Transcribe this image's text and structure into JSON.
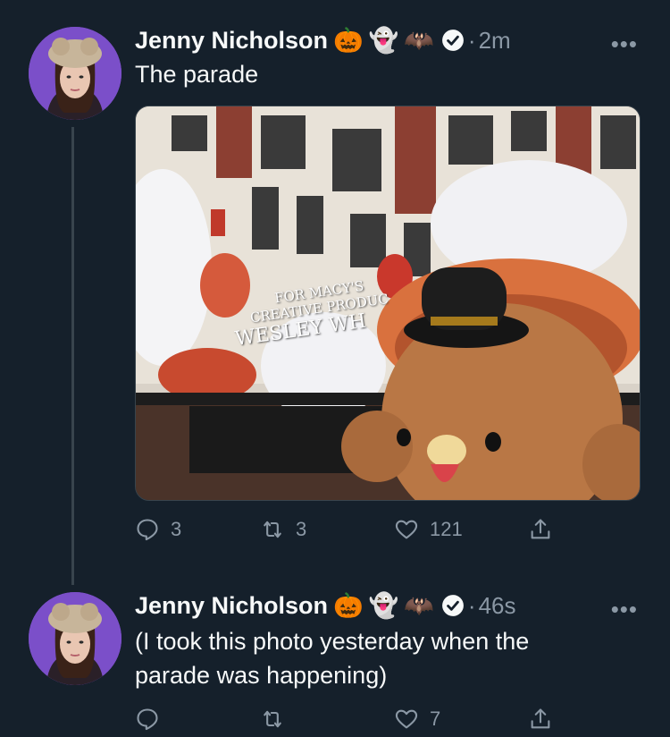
{
  "tweets": [
    {
      "author": "Jenny Nicholson",
      "emoji_badges": [
        "🎃",
        "👻",
        "🦇"
      ],
      "separator": "·",
      "time": "2m",
      "text": "The parade",
      "photo_caption_lines": [
        "FOR MACY'S",
        "CREATIVE PRODUC",
        "WESLEY WH"
      ],
      "reply_count": "3",
      "retweet_count": "3",
      "like_count": "121"
    },
    {
      "author": "Jenny Nicholson",
      "emoji_badges": [
        "🎃",
        "👻",
        "🦇"
      ],
      "separator": "·",
      "time": "46s",
      "text_lines": [
        "(I took this photo yesterday when the",
        "parade was happening)"
      ],
      "reply_count": "",
      "retweet_count": "",
      "like_count": "7"
    }
  ],
  "more_glyph": "•••",
  "colors": {
    "background": "#15202b",
    "text": "#f7f9f9",
    "secondary": "#8b98a5",
    "avatar_bg": "#7b4fc9"
  },
  "icons": [
    "verified-badge-icon",
    "more-icon",
    "reply-icon",
    "retweet-icon",
    "like-icon",
    "share-icon"
  ]
}
